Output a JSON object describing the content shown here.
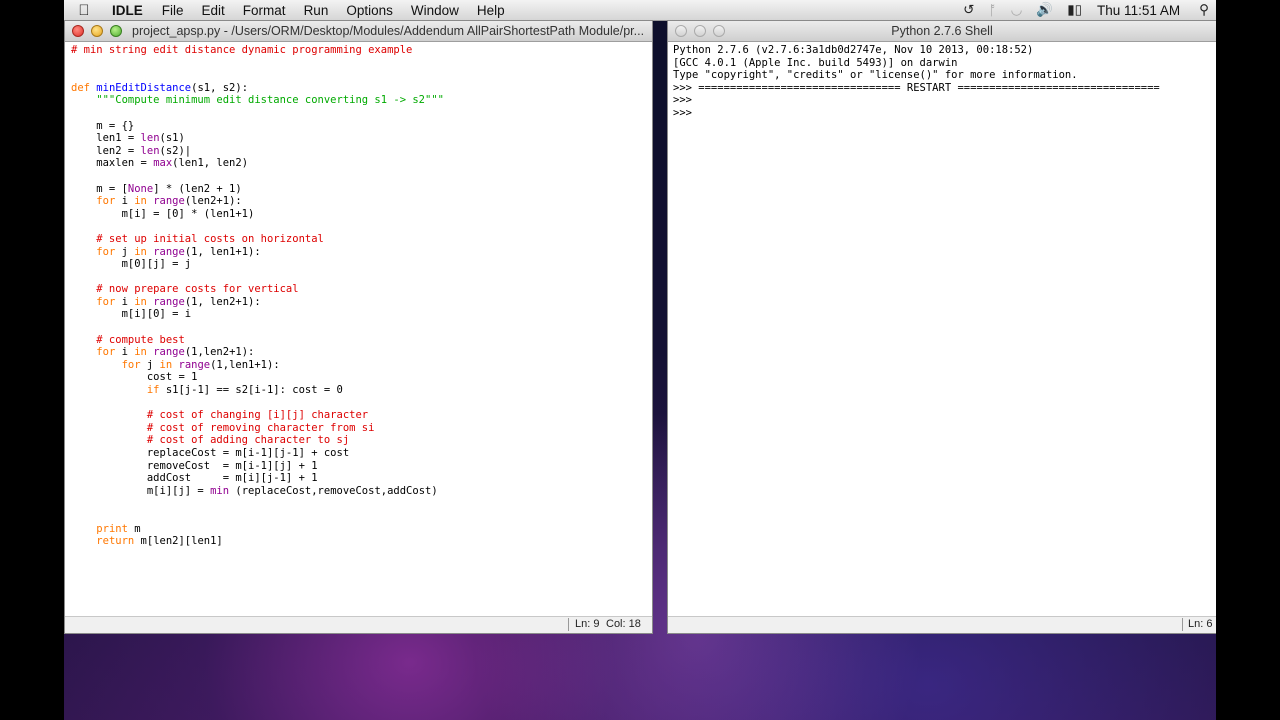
{
  "menubar": {
    "app_name": "IDLE",
    "items": [
      "File",
      "Edit",
      "Format",
      "Run",
      "Options",
      "Window",
      "Help"
    ],
    "clock": "Thu 11:51 AM"
  },
  "editor": {
    "title": "project_apsp.py - /Users/ORM/Desktop/Modules/Addendum AllPairShortestPath Module/pr...",
    "lines": [
      "# min string edit distance dynamic programming example",
      "",
      "",
      "def minEditDistance(s1, s2):",
      "    \"\"\"Compute minimum edit distance converting s1 -> s2\"\"\"",
      "",
      "    m = {}",
      "    len1 = len(s1)",
      "    len2 = len(s2)|",
      "    maxlen = max(len1, len2)",
      "",
      "    m = [None] * (len2 + 1)",
      "    for i in range(len2+1):",
      "        m[i] = [0] * (len1+1)",
      "",
      "    # set up initial costs on horizontal",
      "    for j in range(1, len1+1):",
      "        m[0][j] = j",
      "",
      "    # now prepare costs for vertical",
      "    for i in range(1, len2+1):",
      "        m[i][0] = i",
      "",
      "    # compute best",
      "    for i in range(1,len2+1):",
      "        for j in range(1,len1+1):",
      "            cost = 1",
      "            if s1[j-1] == s2[i-1]: cost = 0",
      "",
      "            # cost of changing [i][j] character",
      "            # cost of removing character from si",
      "            # cost of adding character to sj",
      "            replaceCost = m[i-1][j-1] + cost",
      "            removeCost  = m[i-1][j] + 1",
      "            addCost     = m[i][j-1] + 1",
      "            m[i][j] = min (replaceCost,removeCost,addCost)",
      "",
      "",
      "    print m",
      "    return m[len2][len1]"
    ],
    "status_ln": "Ln: 9",
    "status_col": "Col: 18"
  },
  "shell": {
    "title": "Python 2.7.6 Shell",
    "lines": [
      "Python 2.7.6 (v2.7.6:3a1db0d2747e, Nov 10 2013, 00:18:52)",
      "[GCC 4.0.1 (Apple Inc. build 5493)] on darwin",
      "Type \"copyright\", \"credits\" or \"license()\" for more information.",
      ">>> ================================ RESTART ================================",
      ">>> ",
      ">>> "
    ],
    "status_ln": "Ln: 6"
  }
}
